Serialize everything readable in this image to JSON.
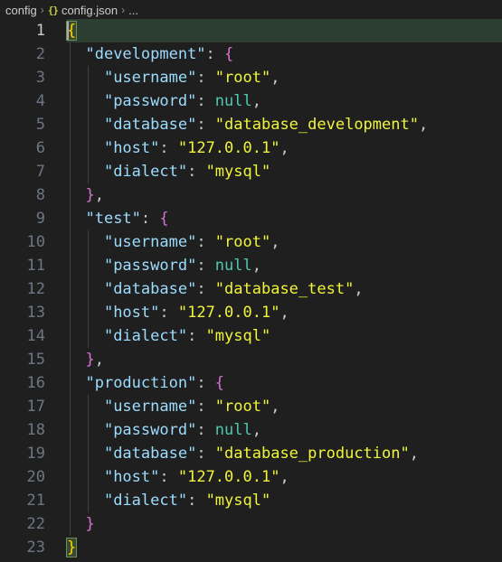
{
  "breadcrumb": {
    "folder": "config",
    "file_icon": "{}",
    "file": "config.json",
    "more": "..."
  },
  "colors": {
    "background": "#1f1f1f",
    "key": "#9cdcfe",
    "string": "#f1f53a",
    "null": "#4ec9b0",
    "bracket_level1": "#ffd700",
    "bracket_level2": "#da70d6",
    "line_number": "#6e7681",
    "current_line_highlight": "#2c3e31"
  },
  "editor": {
    "current_line": 1,
    "lines": [
      {
        "n": "1",
        "indent": 0,
        "tokens": [
          {
            "t": "{",
            "c": "b1"
          }
        ]
      },
      {
        "n": "2",
        "indent": 1,
        "tokens": [
          {
            "t": "\"development\"",
            "c": "key"
          },
          {
            "t": ": ",
            "c": "punc"
          },
          {
            "t": "{",
            "c": "b2"
          }
        ]
      },
      {
        "n": "3",
        "indent": 2,
        "tokens": [
          {
            "t": "\"username\"",
            "c": "key"
          },
          {
            "t": ": ",
            "c": "punc"
          },
          {
            "t": "\"root\"",
            "c": "str"
          },
          {
            "t": ",",
            "c": "punc"
          }
        ]
      },
      {
        "n": "4",
        "indent": 2,
        "tokens": [
          {
            "t": "\"password\"",
            "c": "key"
          },
          {
            "t": ": ",
            "c": "punc"
          },
          {
            "t": "null",
            "c": "null"
          },
          {
            "t": ",",
            "c": "punc"
          }
        ]
      },
      {
        "n": "5",
        "indent": 2,
        "tokens": [
          {
            "t": "\"database\"",
            "c": "key"
          },
          {
            "t": ": ",
            "c": "punc"
          },
          {
            "t": "\"database_development\"",
            "c": "str"
          },
          {
            "t": ",",
            "c": "punc"
          }
        ]
      },
      {
        "n": "6",
        "indent": 2,
        "tokens": [
          {
            "t": "\"host\"",
            "c": "key"
          },
          {
            "t": ": ",
            "c": "punc"
          },
          {
            "t": "\"127.0.0.1\"",
            "c": "str"
          },
          {
            "t": ",",
            "c": "punc"
          }
        ]
      },
      {
        "n": "7",
        "indent": 2,
        "tokens": [
          {
            "t": "\"dialect\"",
            "c": "key"
          },
          {
            "t": ": ",
            "c": "punc"
          },
          {
            "t": "\"mysql\"",
            "c": "str"
          }
        ]
      },
      {
        "n": "8",
        "indent": 1,
        "tokens": [
          {
            "t": "}",
            "c": "b2"
          },
          {
            "t": ",",
            "c": "punc"
          }
        ]
      },
      {
        "n": "9",
        "indent": 1,
        "tokens": [
          {
            "t": "\"test\"",
            "c": "key"
          },
          {
            "t": ": ",
            "c": "punc"
          },
          {
            "t": "{",
            "c": "b2"
          }
        ]
      },
      {
        "n": "10",
        "indent": 2,
        "tokens": [
          {
            "t": "\"username\"",
            "c": "key"
          },
          {
            "t": ": ",
            "c": "punc"
          },
          {
            "t": "\"root\"",
            "c": "str"
          },
          {
            "t": ",",
            "c": "punc"
          }
        ]
      },
      {
        "n": "11",
        "indent": 2,
        "tokens": [
          {
            "t": "\"password\"",
            "c": "key"
          },
          {
            "t": ": ",
            "c": "punc"
          },
          {
            "t": "null",
            "c": "null"
          },
          {
            "t": ",",
            "c": "punc"
          }
        ]
      },
      {
        "n": "12",
        "indent": 2,
        "tokens": [
          {
            "t": "\"database\"",
            "c": "key"
          },
          {
            "t": ": ",
            "c": "punc"
          },
          {
            "t": "\"database_test\"",
            "c": "str"
          },
          {
            "t": ",",
            "c": "punc"
          }
        ]
      },
      {
        "n": "13",
        "indent": 2,
        "tokens": [
          {
            "t": "\"host\"",
            "c": "key"
          },
          {
            "t": ": ",
            "c": "punc"
          },
          {
            "t": "\"127.0.0.1\"",
            "c": "str"
          },
          {
            "t": ",",
            "c": "punc"
          }
        ]
      },
      {
        "n": "14",
        "indent": 2,
        "tokens": [
          {
            "t": "\"dialect\"",
            "c": "key"
          },
          {
            "t": ": ",
            "c": "punc"
          },
          {
            "t": "\"mysql\"",
            "c": "str"
          }
        ]
      },
      {
        "n": "15",
        "indent": 1,
        "tokens": [
          {
            "t": "}",
            "c": "b2"
          },
          {
            "t": ",",
            "c": "punc"
          }
        ]
      },
      {
        "n": "16",
        "indent": 1,
        "tokens": [
          {
            "t": "\"production\"",
            "c": "key"
          },
          {
            "t": ": ",
            "c": "punc"
          },
          {
            "t": "{",
            "c": "b2"
          }
        ]
      },
      {
        "n": "17",
        "indent": 2,
        "tokens": [
          {
            "t": "\"username\"",
            "c": "key"
          },
          {
            "t": ": ",
            "c": "punc"
          },
          {
            "t": "\"root\"",
            "c": "str"
          },
          {
            "t": ",",
            "c": "punc"
          }
        ]
      },
      {
        "n": "18",
        "indent": 2,
        "tokens": [
          {
            "t": "\"password\"",
            "c": "key"
          },
          {
            "t": ": ",
            "c": "punc"
          },
          {
            "t": "null",
            "c": "null"
          },
          {
            "t": ",",
            "c": "punc"
          }
        ]
      },
      {
        "n": "19",
        "indent": 2,
        "tokens": [
          {
            "t": "\"database\"",
            "c": "key"
          },
          {
            "t": ": ",
            "c": "punc"
          },
          {
            "t": "\"database_production\"",
            "c": "str"
          },
          {
            "t": ",",
            "c": "punc"
          }
        ]
      },
      {
        "n": "20",
        "indent": 2,
        "tokens": [
          {
            "t": "\"host\"",
            "c": "key"
          },
          {
            "t": ": ",
            "c": "punc"
          },
          {
            "t": "\"127.0.0.1\"",
            "c": "str"
          },
          {
            "t": ",",
            "c": "punc"
          }
        ]
      },
      {
        "n": "21",
        "indent": 2,
        "tokens": [
          {
            "t": "\"dialect\"",
            "c": "key"
          },
          {
            "t": ": ",
            "c": "punc"
          },
          {
            "t": "\"mysql\"",
            "c": "str"
          }
        ]
      },
      {
        "n": "22",
        "indent": 1,
        "tokens": [
          {
            "t": "}",
            "c": "b2"
          }
        ]
      },
      {
        "n": "23",
        "indent": 0,
        "tokens": [
          {
            "t": "}",
            "c": "b1"
          }
        ]
      }
    ]
  }
}
